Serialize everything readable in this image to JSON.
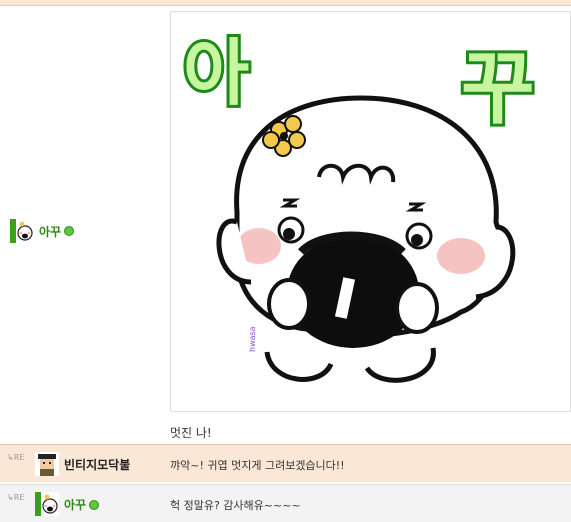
{
  "post": {
    "author": "아꾸",
    "image_title_left": "아",
    "image_title_right": "꾸",
    "image_watermark": "hwasa",
    "body": "멋진 나!"
  },
  "comments": [
    {
      "reply_mark": "RE",
      "author": "빈티지모닥불",
      "text": "꺄악~! 귀엽 멋지게 그려보겠습니다!!"
    },
    {
      "reply_mark": "RE",
      "author": "아꾸",
      "text": "헉 정말유? 감사해유~~~~"
    }
  ],
  "colors": {
    "nick_green": "#2f8a16",
    "comment_highlight": "#fbe7d6",
    "comment_default": "#f3f3f3",
    "title_fill": "#c8f5a0",
    "title_outline": "#1d8a1a"
  }
}
